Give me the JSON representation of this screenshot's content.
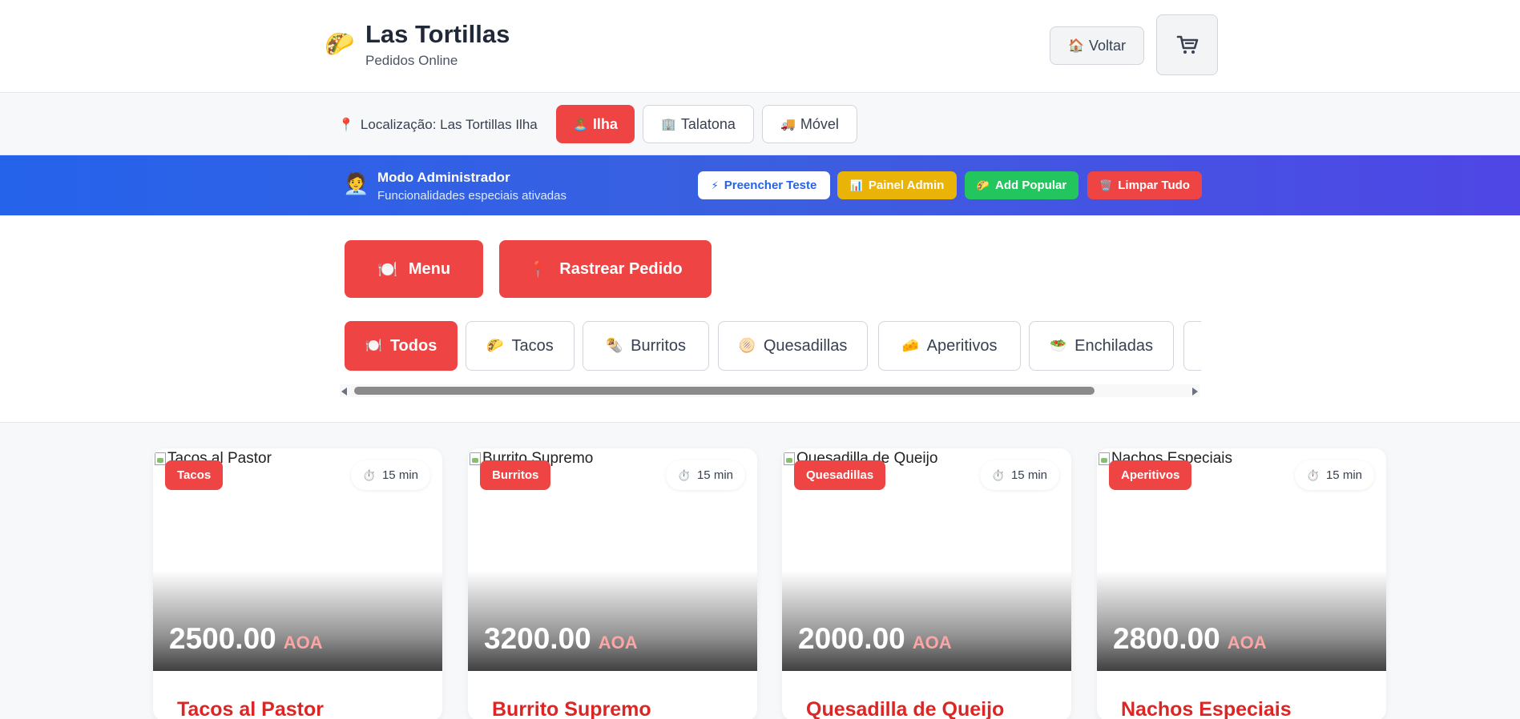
{
  "header": {
    "logo_icon": "taco-icon",
    "title": "Las Tortillas",
    "subtitle": "Pedidos Online",
    "back_label": "Voltar",
    "back_icon": "house-icon",
    "cart_icon": "cart-icon"
  },
  "location": {
    "label": "Localização: Las Tortillas Ilha",
    "options": [
      {
        "label": "Ilha",
        "icon": "🏝️",
        "active": true
      },
      {
        "label": "Talatona",
        "icon": "🏢",
        "active": false
      },
      {
        "label": "Móvel",
        "icon": "🚚",
        "active": false
      }
    ]
  },
  "admin": {
    "title": "Modo Administrador",
    "subtitle": "Funcionalidades especiais ativadas",
    "buttons": [
      {
        "label": "Preencher Teste",
        "icon": "⚡",
        "color": "#ffffff"
      },
      {
        "label": "Painel Admin",
        "icon": "📊",
        "color": "#eab308"
      },
      {
        "label": "Add Popular",
        "icon": "🌮",
        "color": "#22c55e"
      },
      {
        "label": "Limpar Tudo",
        "icon": "🗑️",
        "color": "#ef4444"
      }
    ]
  },
  "main": {
    "menu_label": "Menu",
    "track_label": "Rastrear Pedido"
  },
  "categories": [
    {
      "label": "Todos",
      "icon": "🍽️",
      "active": true
    },
    {
      "label": "Tacos",
      "icon": "🌮",
      "active": false
    },
    {
      "label": "Burritos",
      "icon": "🌯",
      "active": false
    },
    {
      "label": "Quesadillas",
      "icon": "🫓",
      "active": false
    },
    {
      "label": "Aperitivos",
      "icon": "🧀",
      "active": false
    },
    {
      "label": "Enchiladas",
      "icon": "🥗",
      "active": false
    }
  ],
  "products": [
    {
      "name": "Tacos al Pastor",
      "alt": "Tacos al Pastor",
      "category": "Tacos",
      "time": "15 min",
      "price": "2500.00",
      "currency": "AOA"
    },
    {
      "name": "Burrito Supremo",
      "alt": "Burrito Supremo",
      "category": "Burritos",
      "time": "15 min",
      "price": "3200.00",
      "currency": "AOA"
    },
    {
      "name": "Quesadilla de Queijo",
      "alt": "Quesadilla de Queijo",
      "category": "Quesadillas",
      "time": "15 min",
      "price": "2000.00",
      "currency": "AOA"
    },
    {
      "name": "Nachos Especiais",
      "alt": "Nachos Especiais",
      "category": "Aperitivos",
      "time": "15 min",
      "price": "2800.00",
      "currency": "AOA"
    }
  ],
  "colors": {
    "accent": "#ef4444",
    "admin_gradient_start": "#2563eb",
    "admin_gradient_end": "#4f46e5"
  }
}
